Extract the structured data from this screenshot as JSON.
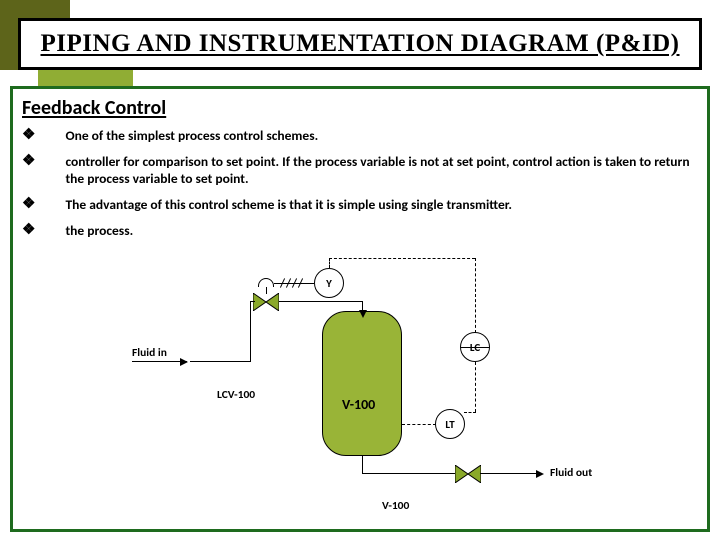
{
  "title": "PIPING AND INSTRUMENTATION DIAGRAM (P&ID)",
  "section": "Feedback Control",
  "bullets": [
    "One of the simplest process control schemes.",
    "controller for comparison to set point. If the process variable is not at set point, control action is taken to return the process variable to set point.",
    "The advantage of this control scheme is that it is simple using single transmitter.",
    "the process."
  ],
  "diagram": {
    "solenoid": "Y",
    "controller": "LC",
    "transmitter": "LT",
    "fluid_in": "Fluid in",
    "valve_tag": "LCV-100",
    "vessel_tag": "V-100",
    "bottom_valve": "V-100",
    "fluid_out": "Fluid out"
  }
}
